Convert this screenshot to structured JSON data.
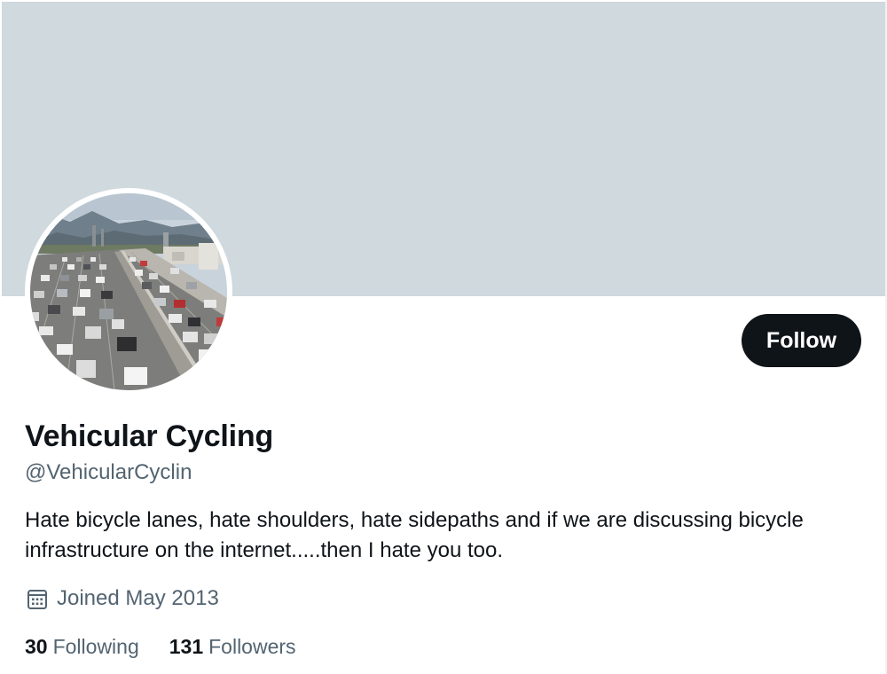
{
  "profile": {
    "display_name": "Vehicular Cycling",
    "handle": "@VehicularCyclin",
    "bio": "Hate bicycle lanes, hate shoulders, hate sidepaths and if we are discussing bicycle infrastructure on the internet.....then I hate you too.",
    "joined": "Joined May 2013",
    "joined_icon": "calendar-icon",
    "avatar_subject": "highway traffic photo"
  },
  "actions": {
    "follow_label": "Follow"
  },
  "stats": {
    "following_count": "30",
    "following_label": "Following",
    "followers_count": "131",
    "followers_label": "Followers"
  },
  "colors": {
    "banner": "#cfd9de",
    "button_bg": "#0f1419",
    "button_text": "#ffffff",
    "primary_text": "#0f1419",
    "secondary_text": "#536471"
  }
}
